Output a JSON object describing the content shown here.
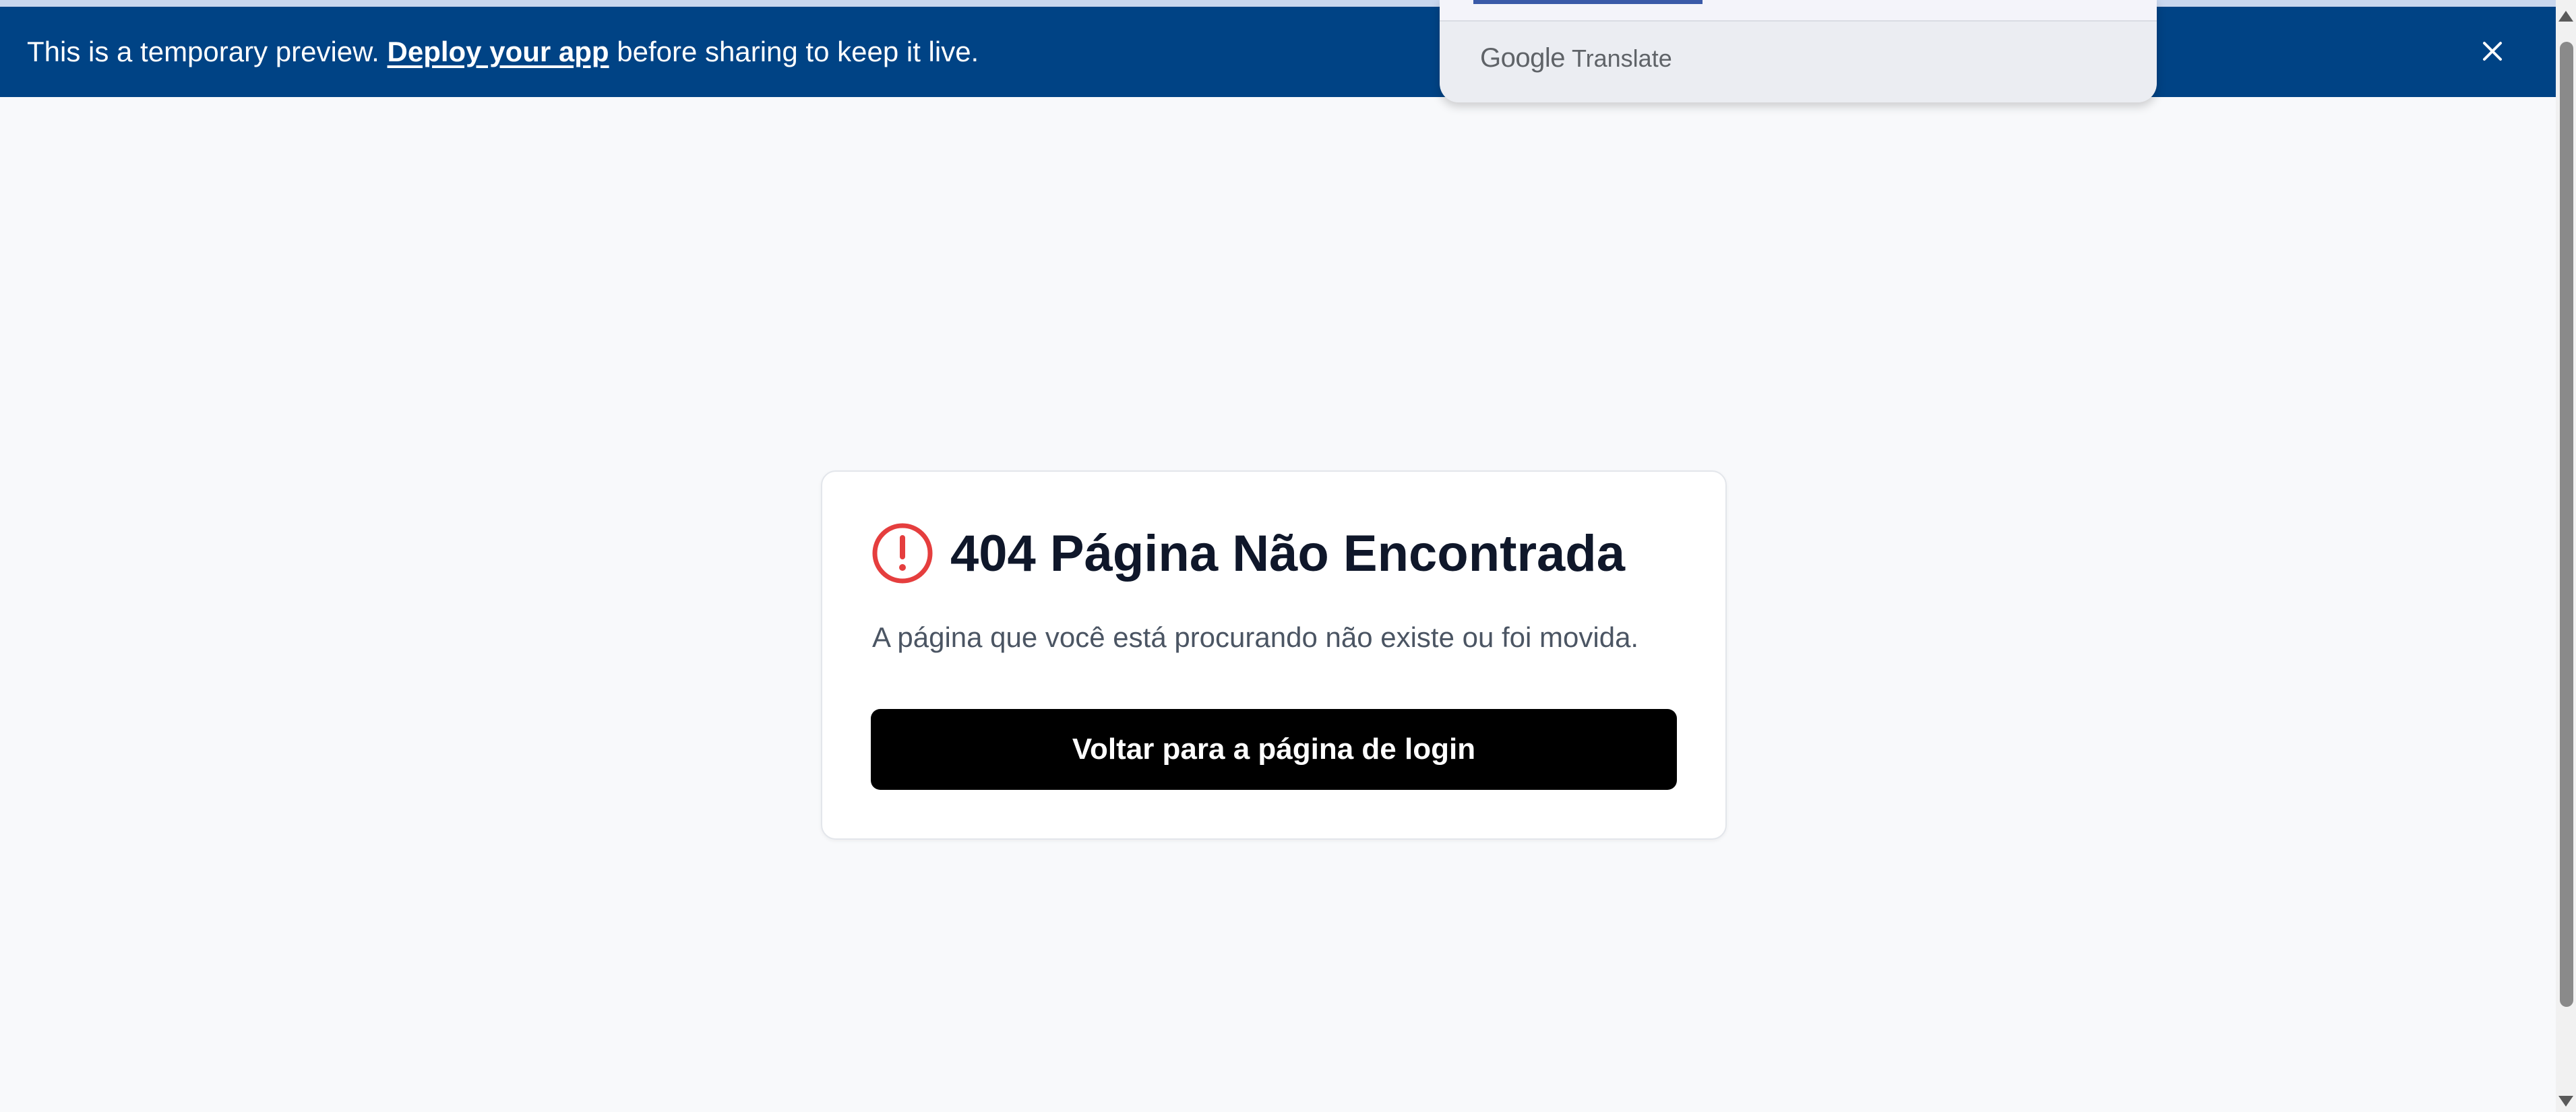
{
  "banner": {
    "text_before": "This is a temporary preview. ",
    "link_label": "Deploy your app",
    "text_after": " before sharing to keep it live.",
    "close_icon": "close-icon",
    "background_color": "#004385"
  },
  "translate_popup": {
    "brand_logo": "Google",
    "brand_product": "Translate"
  },
  "error_card": {
    "icon": "alert-circle-icon",
    "icon_color": "#e53e3e",
    "title": "404 Página Não Encontrada",
    "description": "A página que você está procurando não existe ou foi movida.",
    "button_label": "Voltar para a página de login"
  }
}
